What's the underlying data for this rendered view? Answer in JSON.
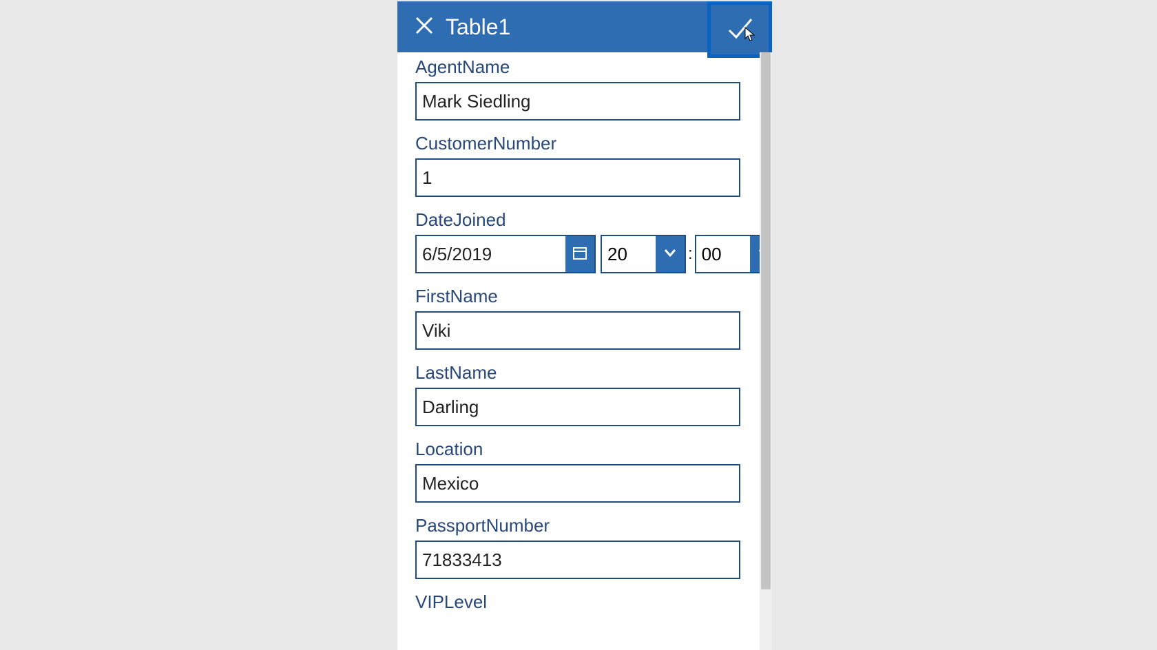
{
  "header": {
    "title": "Table1"
  },
  "fields": {
    "agentName": {
      "label": "AgentName",
      "value": "Mark Siedling"
    },
    "customerNumber": {
      "label": "CustomerNumber",
      "value": "1"
    },
    "dateJoined": {
      "label": "DateJoined",
      "date": "6/5/2019",
      "hour": "20",
      "minute": "00"
    },
    "firstName": {
      "label": "FirstName",
      "value": "Viki"
    },
    "lastName": {
      "label": "LastName",
      "value": "Darling"
    },
    "location": {
      "label": "Location",
      "value": "Mexico"
    },
    "passportNumber": {
      "label": "PassportNumber",
      "value": "71833413"
    },
    "vipLevel": {
      "label": "VIPLevel"
    }
  },
  "timeSeparator": ":"
}
